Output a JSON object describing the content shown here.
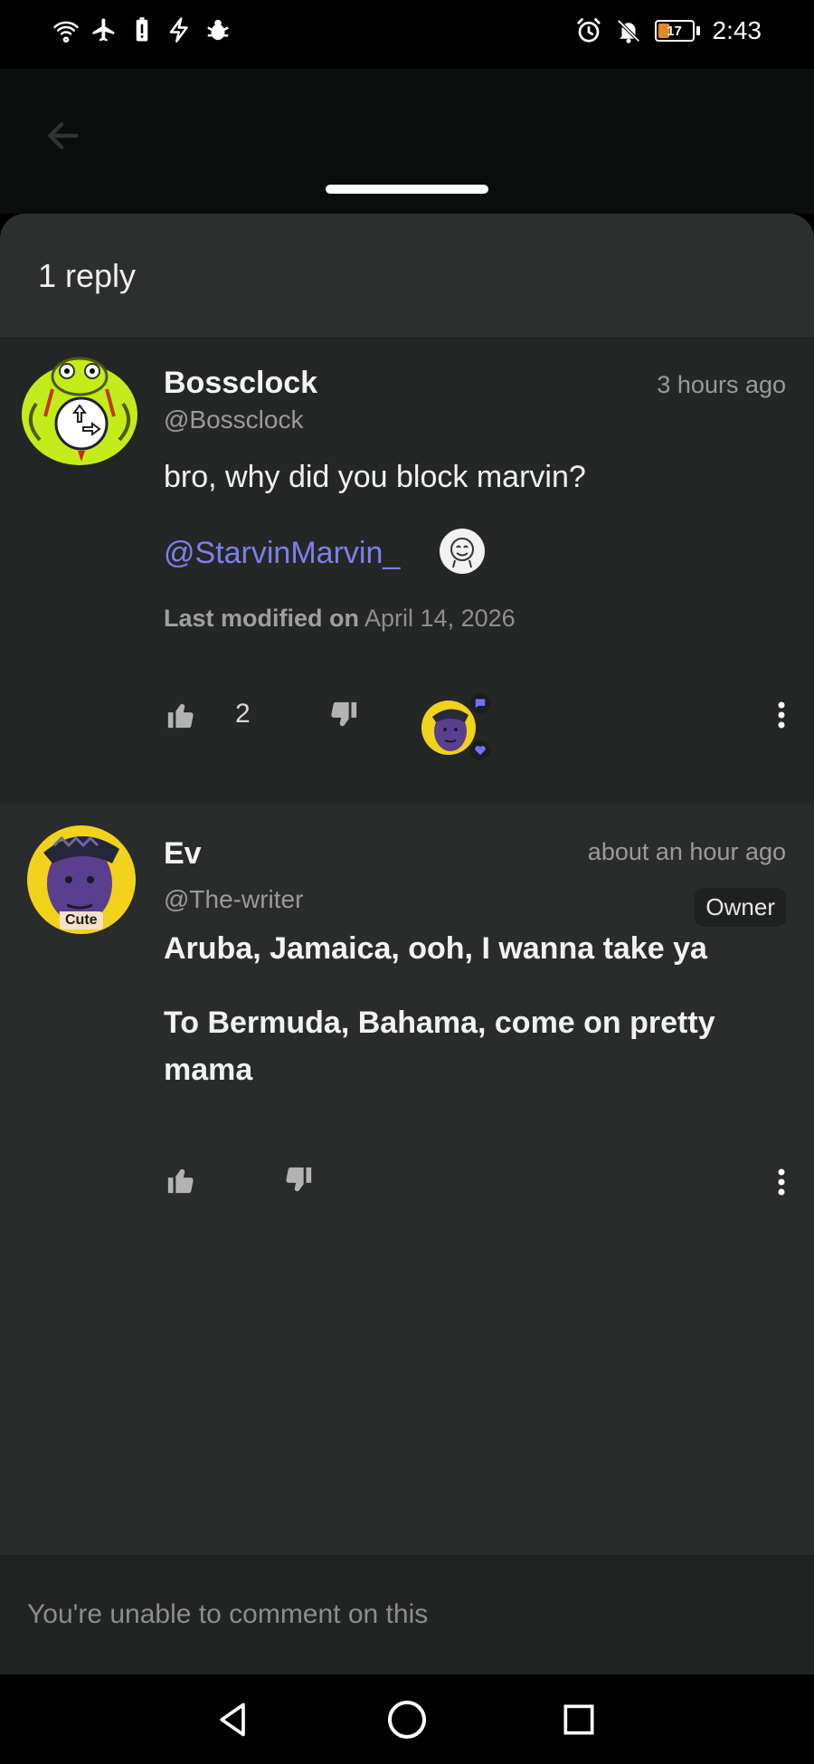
{
  "status_bar": {
    "time": "2:43",
    "battery_level": "17",
    "icons_left": [
      "wifi-icon",
      "airplane-icon",
      "battery-alert-icon",
      "flash-icon",
      "bug-icon"
    ],
    "icons_right": [
      "alarm-icon",
      "notifications-off-icon"
    ]
  },
  "sheet": {
    "title": "1 reply"
  },
  "comments": [
    {
      "author": "Bossclock",
      "handle": "@Bossclock",
      "time": "3 hours ago",
      "text": "bro, why did you block marvin?",
      "mention": "@StarvinMarvin_",
      "modified_label": "Last modified on",
      "modified_date": "April 14, 2026",
      "likes": "2"
    },
    {
      "author": "Ev",
      "handle": "@The-writer",
      "time": "about an hour ago",
      "badge": "Owner",
      "avatar_tag": "Cute",
      "lines": [
        "Aruba, Jamaica, ooh, I wanna take ya",
        "To Bermuda, Bahama, come on pretty mama"
      ]
    }
  ],
  "footer": {
    "text": "You're unable to comment on this"
  },
  "colors": {
    "accent_mention": "#7d80ea",
    "background": "#2a2c2b",
    "avatar_yellow": "#f2d21b",
    "frog_green": "#c4ec1a"
  }
}
